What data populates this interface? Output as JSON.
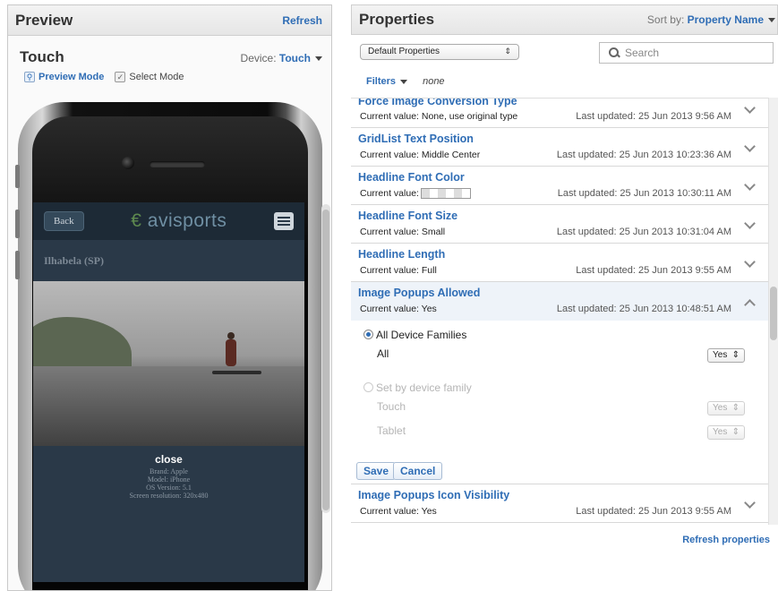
{
  "preview": {
    "title": "Preview",
    "refresh_label": "Refresh",
    "device_title": "Touch",
    "device_label": "Device:",
    "device_value": "Touch",
    "modes": [
      {
        "label": "Preview Mode",
        "active": true
      },
      {
        "label": "Select Mode",
        "active": false
      }
    ],
    "phone_screen": {
      "back_label": "Back",
      "logo_prefix": "€",
      "logo_text": "avisports",
      "location": "Ilhabela (SP)",
      "close_label": "close",
      "device_info": [
        "Brand: Apple",
        "Model: iPhone",
        "OS Version: 5.1",
        "Screen resolution: 320x480"
      ]
    }
  },
  "properties": {
    "title": "Properties",
    "sort_label": "Sort by:",
    "sort_value": "Property Name",
    "property_set": "Default Properties",
    "search_placeholder": "Search",
    "filters_label": "Filters",
    "filters_value": "none",
    "items": [
      {
        "name": "Force Image Conversion Type",
        "current": "Current value: None, use original type",
        "updated": "Last updated: 25 Jun 2013 9:56 AM"
      },
      {
        "name": "GridList Text Position",
        "current": "Current value: Middle Center",
        "updated": "Last updated: 25 Jun 2013 10:23:36 AM"
      },
      {
        "name": "Headline Font Color",
        "current": "Current value:",
        "updated": "Last updated: 25 Jun 2013 10:30:11 AM"
      },
      {
        "name": "Headline Font Size",
        "current": "Current value: Small",
        "updated": "Last updated: 25 Jun 2013 10:31:04 AM"
      },
      {
        "name": "Headline Length",
        "current": "Current value: Full",
        "updated": "Last updated: 25 Jun 2013 9:55 AM"
      },
      {
        "name": "Image Popups Allowed",
        "current": "Current value: Yes",
        "updated": "Last updated: 25 Jun 2013 10:48:51 AM"
      },
      {
        "name": "Image Popups Icon Visibility",
        "current": "Current value: Yes",
        "updated": "Last updated: 25 Jun 2013 9:55 AM"
      }
    ],
    "expanded": {
      "all_families_label": "All Device Families",
      "all_label": "All",
      "all_value": "Yes",
      "by_family_label": "Set by device family",
      "touch_label": "Touch",
      "touch_value": "Yes",
      "tablet_label": "Tablet",
      "tablet_value": "Yes",
      "save_label": "Save",
      "cancel_label": "Cancel"
    },
    "refresh_properties_label": "Refresh properties"
  },
  "colors": {
    "link": "#2f6db5",
    "selected_row": "#eef3f9"
  }
}
